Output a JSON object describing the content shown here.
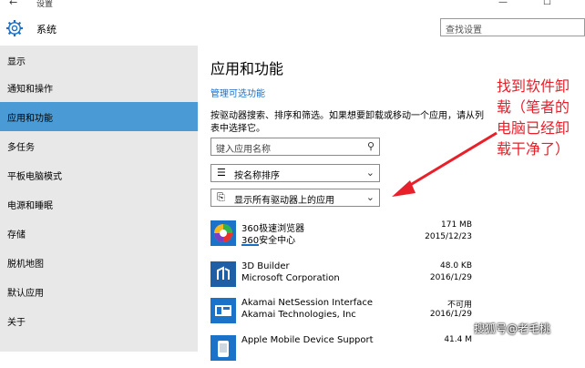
{
  "titlebar": {
    "back": "←",
    "title": "设置",
    "minimize": "—",
    "maximize": "☐"
  },
  "header": {
    "section": "系统",
    "search_placeholder": "查找设置"
  },
  "sidebar": {
    "items": [
      {
        "label": "显示"
      },
      {
        "label": "通知和操作"
      },
      {
        "label": "应用和功能",
        "active": true
      },
      {
        "label": "多任务"
      },
      {
        "label": "平板电脑模式"
      },
      {
        "label": "电源和睡眠"
      },
      {
        "label": "存储"
      },
      {
        "label": "脱机地图"
      },
      {
        "label": "默认应用"
      },
      {
        "label": "关于"
      }
    ]
  },
  "main": {
    "title": "应用和功能",
    "manage_link": "管理可选功能",
    "description": "按驱动器搜索、排序和筛选。如果想要卸载或移动一个应用，请从列表中选择它。",
    "search_placeholder": "键入应用名称",
    "sort_value": "按名称排序",
    "filter_value": "显示所有驱动器上的应用",
    "apps": [
      {
        "name": "360极速浏览器",
        "publisher": "360安全中心",
        "size": "171 MB",
        "date": "2015/12/23"
      },
      {
        "name": "3D Builder",
        "publisher": "Microsoft Corporation",
        "size": "48.0 KB",
        "date": "2016/1/29"
      },
      {
        "name": "Akamai NetSession Interface",
        "publisher": "Akamai Technologies, Inc",
        "size": "不可用",
        "date": "2016/1/29"
      },
      {
        "name": "Apple Mobile Device Support",
        "publisher": "",
        "size": "41.4 M",
        "date": ""
      }
    ]
  },
  "annotation": "找到软件卸载（笔者的电脑已经卸载干净了）",
  "watermark": "搜狐号@老毛桃",
  "colors": {
    "accent": "#4a9bd5",
    "link": "#1a6fc4",
    "annotation": "#e8202a"
  }
}
